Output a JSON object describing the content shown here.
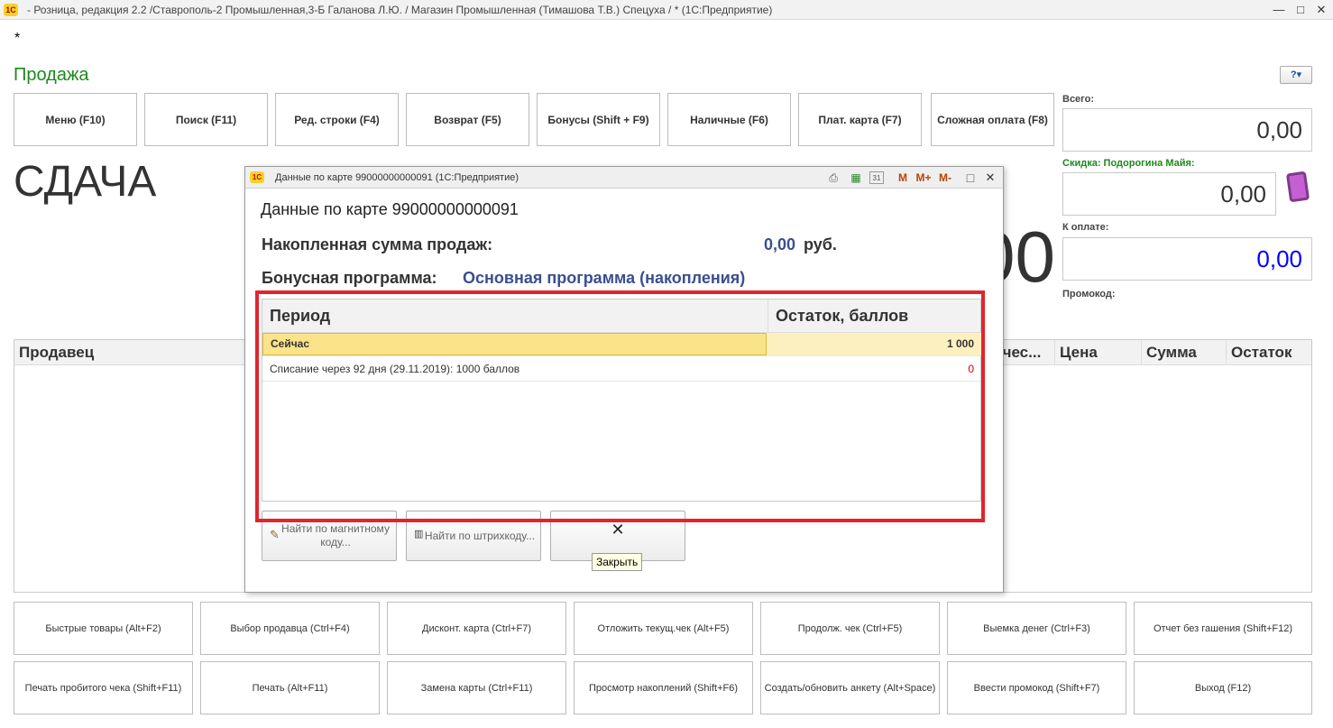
{
  "window": {
    "app_logo": "1С",
    "title": "- Розница, редакция 2.2 /Ставрополь-2 Промышленная,3-Б Галанова Л.Ю. / Магазин Промышленная (Тимашова Т.В.) Спецуха / * (1С:Предприятие)",
    "controls": {
      "minimize": "—",
      "maximize": "□",
      "close": "✕"
    }
  },
  "modified_marker": "*",
  "page_title": "Продажа",
  "help": "?▾",
  "top_buttons": [
    "Меню (F10)",
    "Поиск (F11)",
    "Ред. строки (F4)",
    "Возврат (F5)",
    "Бонусы (Shift + F9)",
    "Наличные (F6)",
    "Плат. карта (F7)",
    "Сложная оплата (F8)"
  ],
  "change": {
    "label": "СДАЧА",
    "value": "0,00"
  },
  "totals": {
    "total_label": "Всего:",
    "total_value": "0,00",
    "discount_label": "Скидка: Подорогина Майя:",
    "discount_value": "0,00",
    "to_pay_label": "К оплате:",
    "to_pay_value": "0,00",
    "promo_label": "Промокод:",
    "to_pay_color": "#0000ff"
  },
  "grid": {
    "columns": [
      "Продавец",
      "Количес...",
      "Цена",
      "Сумма",
      "Остаток"
    ]
  },
  "bottom_buttons_row1": [
    "Быстрые товары (Alt+F2)",
    "Выбор продавца (Ctrl+F4)",
    "Дисконт. карта (Ctrl+F7)",
    "Отложить текущ.чек (Alt+F5)",
    "Продолж. чек (Ctrl+F5)",
    "Выемка денег (Ctrl+F3)",
    "Отчет без гашения (Shift+F12)"
  ],
  "bottom_buttons_row2": [
    "Печать пробитого чека (Shift+F11)",
    "Печать (Alt+F11)",
    "Замена карты (Ctrl+F11)",
    "Просмотр накоплений (Shift+F6)",
    "Создать/обновить анкету (Alt+Space)",
    "Ввести промокод (Shift+F7)",
    "Выход (F12)"
  ],
  "dialog": {
    "logo": "1С",
    "title": "Данные по карте 99000000000091  (1С:Предприятие)",
    "tools": {
      "print": "⎙",
      "calc": "▦",
      "calendar": "31",
      "m": "M",
      "m_plus": "M+",
      "m_minus": "M-",
      "maximize": "□",
      "close": "✕"
    },
    "heading": "Данные по карте 99000000000091",
    "sum_label": "Накопленная сумма продаж:",
    "sum_value": "0,00",
    "currency": "руб.",
    "program_label": "Бонусная программа:",
    "program_value": "Основная программа (накопления)",
    "table": {
      "headers": [
        "Период",
        "Остаток, баллов"
      ],
      "rows": [
        {
          "period": "Сейчас",
          "balance": "1 000",
          "selected": true
        },
        {
          "period": "Списание через 92 дня (29.11.2019): 1000 баллов",
          "balance": "0",
          "selected": false
        }
      ]
    },
    "buttons": {
      "magnetic": "Найти по магнитному коду...",
      "barcode": "Найти по штрихкоду...",
      "close": "✕"
    },
    "tooltip": "Закрыть"
  }
}
